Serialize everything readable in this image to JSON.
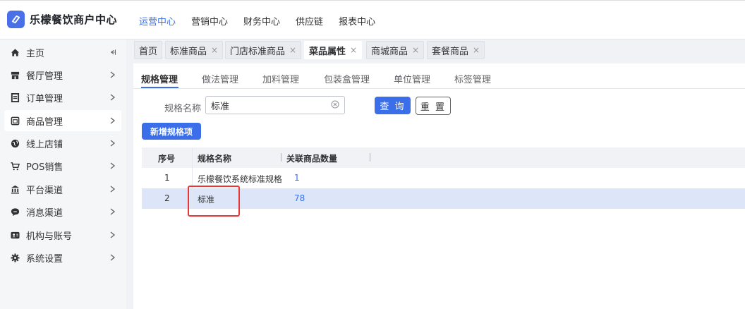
{
  "app": {
    "brand": "乐檬餐饮商户中心",
    "logo_icon": "leaf-logo-icon",
    "accent_color": "#3b6ee8"
  },
  "topnav": {
    "items": [
      {
        "label": "运营中心",
        "active": true
      },
      {
        "label": "营销中心",
        "active": false
      },
      {
        "label": "财务中心",
        "active": false
      },
      {
        "label": "供应链",
        "active": false
      },
      {
        "label": "报表中心",
        "active": false
      }
    ]
  },
  "sidebar": {
    "items": [
      {
        "label": "主页",
        "icon": "home-icon",
        "arrow": "collapse-icon"
      },
      {
        "label": "餐厅管理",
        "icon": "store-icon",
        "arrow": "chevron-right-icon"
      },
      {
        "label": "订单管理",
        "icon": "order-icon",
        "arrow": "chevron-right-icon"
      },
      {
        "label": "商品管理",
        "icon": "product-icon",
        "arrow": "chevron-right-icon",
        "active": true
      },
      {
        "label": "线上店铺",
        "icon": "globe-icon",
        "arrow": "chevron-right-icon"
      },
      {
        "label": "POS销售",
        "icon": "cart-icon",
        "arrow": "chevron-right-icon"
      },
      {
        "label": "平台渠道",
        "icon": "bank-icon",
        "arrow": "chevron-right-icon"
      },
      {
        "label": "消息渠道",
        "icon": "message-icon",
        "arrow": "chevron-right-icon"
      },
      {
        "label": "机构与账号",
        "icon": "id-card-icon",
        "arrow": "chevron-right-icon"
      },
      {
        "label": "系统设置",
        "icon": "gear-icon",
        "arrow": "chevron-right-icon"
      }
    ]
  },
  "tags": {
    "items": [
      {
        "label": "首页",
        "closable": false,
        "active": false
      },
      {
        "label": "标准商品",
        "closable": true,
        "active": false
      },
      {
        "label": "门店标准商品",
        "closable": true,
        "active": false
      },
      {
        "label": "菜品属性",
        "closable": true,
        "active": true
      },
      {
        "label": "商城商品",
        "closable": true,
        "active": false
      },
      {
        "label": "套餐商品",
        "closable": true,
        "active": false
      }
    ],
    "close_glyph": "×"
  },
  "subtabs": {
    "items": [
      {
        "label": "规格管理",
        "active": true
      },
      {
        "label": "做法管理",
        "active": false
      },
      {
        "label": "加料管理",
        "active": false
      },
      {
        "label": "包装盒管理",
        "active": false
      },
      {
        "label": "单位管理",
        "active": false
      },
      {
        "label": "标签管理",
        "active": false
      }
    ]
  },
  "search": {
    "label": "规格名称",
    "value": "标准",
    "query_button": "查 询",
    "reset_button": "重 置"
  },
  "add_button": "新增规格项",
  "table": {
    "columns": [
      "序号",
      "规格名称",
      "关联商品数量"
    ],
    "rows": [
      {
        "index": "1",
        "name": "乐檬餐饮系统标准规格",
        "count": "1",
        "selected": false
      },
      {
        "index": "2",
        "name": "标准",
        "count": "78",
        "selected": true
      }
    ]
  },
  "annotation": {
    "color": "#e53935"
  }
}
